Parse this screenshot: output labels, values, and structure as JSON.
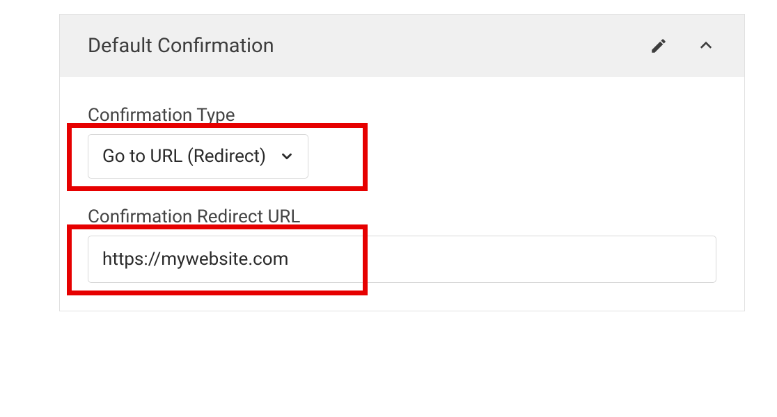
{
  "panel": {
    "title": "Default Confirmation"
  },
  "fields": {
    "confirmation_type": {
      "label": "Confirmation Type",
      "value": "Go to URL (Redirect)"
    },
    "redirect_url": {
      "label": "Confirmation Redirect URL",
      "value": "https://mywebsite.com"
    }
  },
  "icons": {
    "edit": "edit-icon",
    "collapse": "chevron-up-icon",
    "dropdown": "chevron-down-icon"
  },
  "colors": {
    "highlight": "#e60000",
    "header_bg": "#f0f0f0",
    "border": "#d8d8d8",
    "text": "#3d3d3d"
  }
}
